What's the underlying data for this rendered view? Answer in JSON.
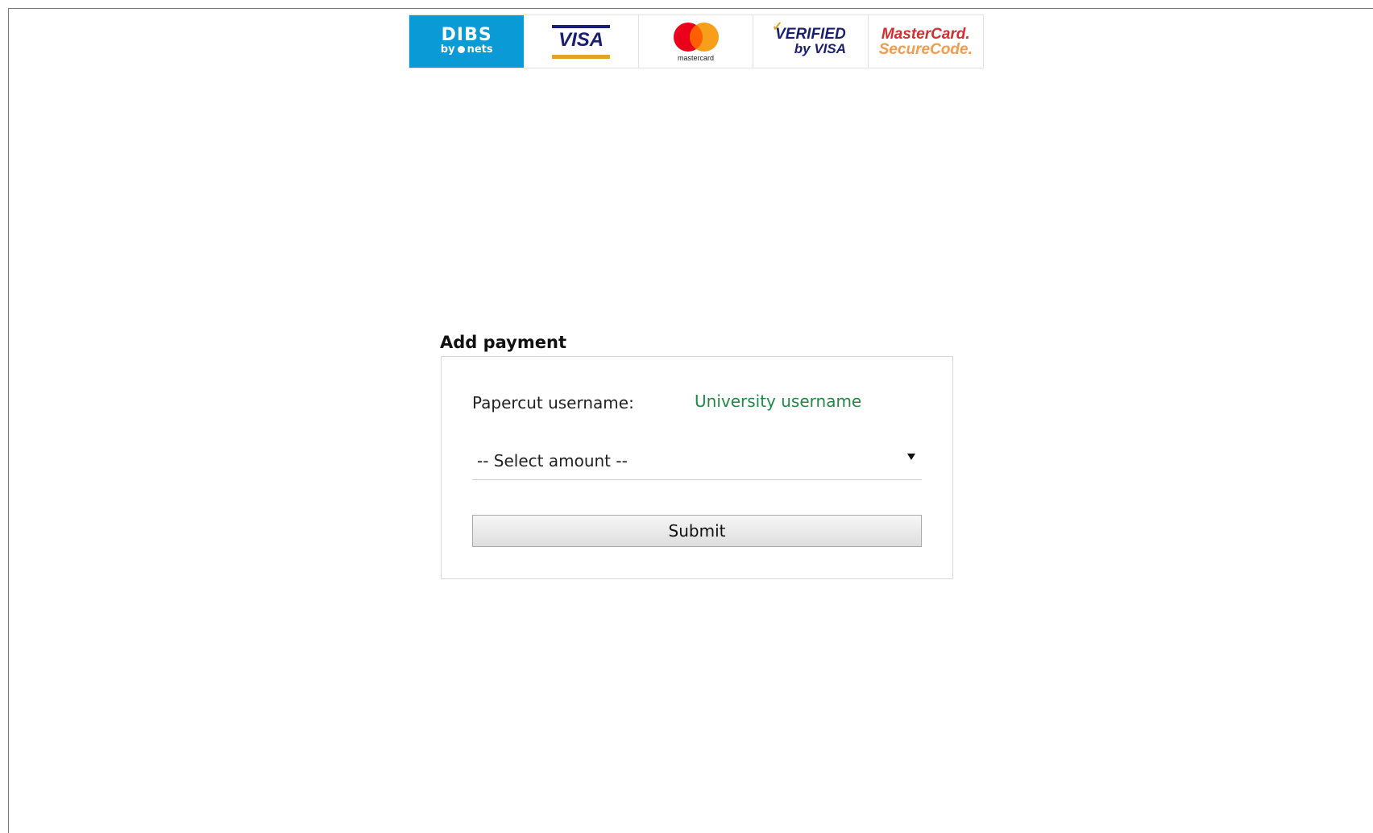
{
  "logos": {
    "dibs": {
      "main": "DIBS",
      "sub": "nets",
      "by": "by",
      "color": "#0a9ad6"
    },
    "visa": {
      "text": "VISA",
      "navy": "#1a1f71",
      "gold": "#e0a526"
    },
    "mastercard": {
      "caption": "mastercard",
      "red": "#eb001b",
      "orange": "#f79e1b"
    },
    "verified_by_visa": {
      "top": "ERIFIED",
      "prefix": "V",
      "bottom": "by VISA"
    },
    "securecode": {
      "top": "MasterCard.",
      "bottom": "SecureCode."
    }
  },
  "form": {
    "title": "Add payment",
    "username_label": "Papercut username:",
    "username_value": "University username",
    "username_color": "#1e8a44",
    "amount_select": {
      "selected": "-- Select amount --"
    },
    "submit_label": "Submit"
  }
}
